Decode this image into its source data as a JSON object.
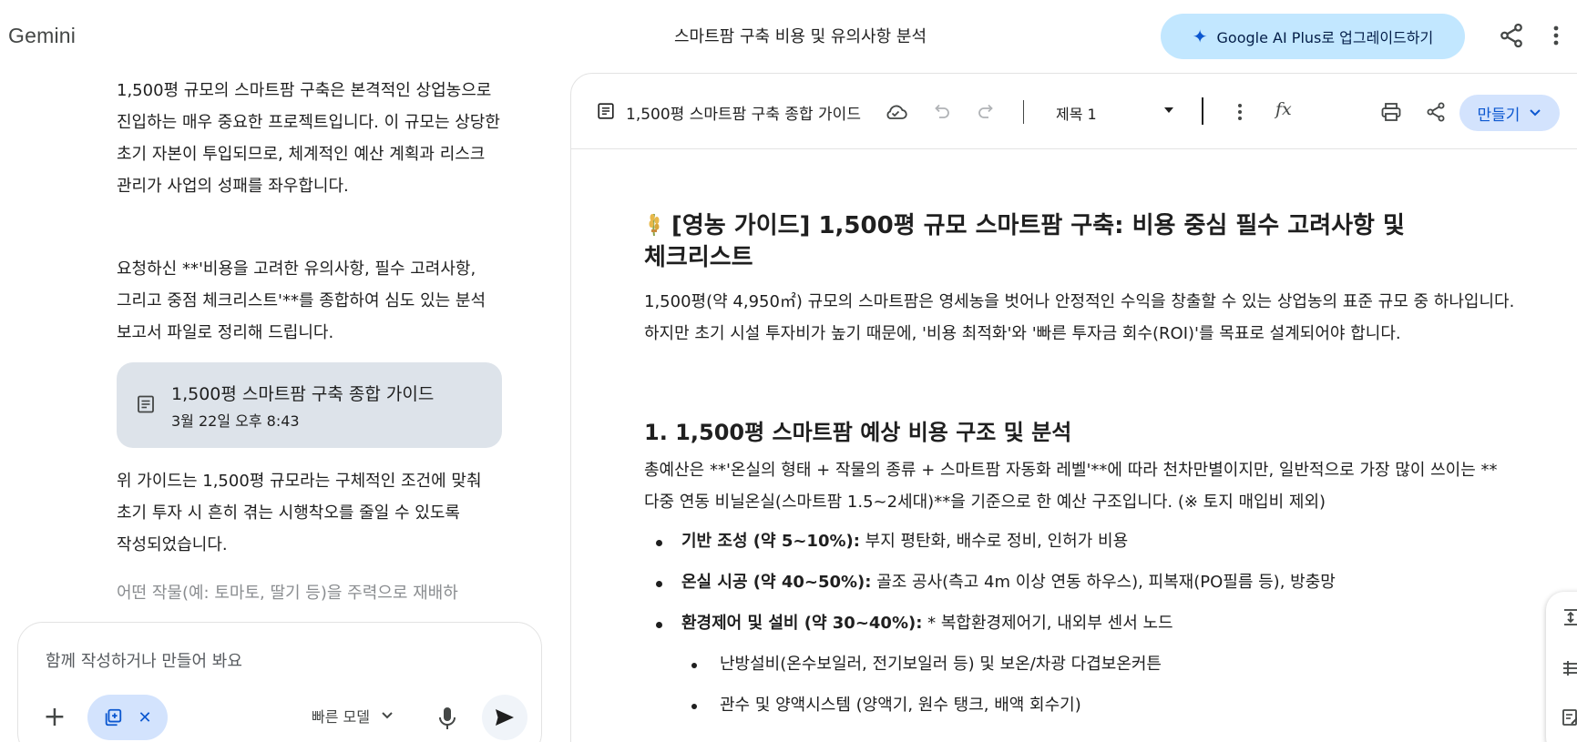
{
  "app": {
    "name": "Gemini"
  },
  "header": {
    "title": "스마트팜 구축 비용 및 유의사항 분석",
    "upgrade_label": "Google AI Plus로 업그레이드하기"
  },
  "chat": {
    "paragraph1": "1,500평 규모의 스마트팜 구축은 본격적인 상업농으로 진입하는 매우 중요한 프로젝트입니다. 이 규모는 상당한 초기 자본이 투입되므로, 체계적인 예산 계획과 리스크 관리가 사업의 성패를 좌우합니다.",
    "paragraph2": "요청하신 **'비용을 고려한 유의사항, 필수 고려사항, 그리고 중점 체크리스트'**를 종합하여 심도 있는 분석 보고서 파일로 정리해 드립니다.",
    "doc_card": {
      "title": "1,500평 스마트팜 구축 종합 가이드",
      "date": "3월 22일 오후 8:43"
    },
    "paragraph3": "위 가이드는 1,500평 규모라는 구체적인 조건에 맞춰 초기 투자 시 흔히 겪는 시행착오를 줄일 수 있도록 작성되었습니다.",
    "paragraph4": "어떤 작물(예: 토마토, 딸기 등)을 주력으로 재배하"
  },
  "input": {
    "placeholder": "함께 작성하거나 만들어 봐요",
    "model_label": "빠른 모델"
  },
  "doc": {
    "toolbar": {
      "title": "1,500평 스마트팜 구축 종합 가이드",
      "style_label": "제목 1",
      "make_label": "만들기"
    },
    "heading": "[영농 가이드] 1,500평 규모 스마트팜 구축: 비용 중심 필수 고려사항 및 체크리스트",
    "intro": "1,500평(약 4,950㎡) 규모의 스마트팜은 영세농을 벗어나 안정적인 수익을 창출할 수 있는 상업농의 표준 규모 중 하나입니다. 하지만 초기 시설 투자비가 높기 때문에, '비용 최적화'와 '빠른 투자금 회수(ROI)'를 목표로 설계되어야 합니다.",
    "section1_title": "1. 1,500평 스마트팜 예상 비용 구조 및 분석",
    "section1_text": "총예산은 **'온실의 형태 + 작물의 종류 + 스마트팜 자동화 레벨'**에 따라 천차만별이지만, 일반적으로 가장 많이 쓰이는 **다중 연동 비닐온실(스마트팜 1.5~2세대)**을 기준으로 한 예산 구조입니다. (※ 토지 매입비 제외)",
    "items": [
      {
        "label": "기반 조성 (약 5~10%):",
        "text": " 부지 평탄화, 배수로 정비, 인허가 비용"
      },
      {
        "label": "온실 시공 (약 40~50%):",
        "text": " 골조 공사(측고 4m 이상 연동 하우스), 피복재(PO필름 등), 방충망"
      },
      {
        "label": "환경제어 및 설비 (약 30~40%):",
        "text": " * 복합환경제어기, 내외부 센서 노드"
      }
    ],
    "subitems": [
      "난방설비(온수보일러, 전기보일러 등) 및 보온/차광 다겹보온커튼",
      "관수 및 양액시스템 (양액기, 원수 탱크, 배액 회수기)"
    ]
  }
}
